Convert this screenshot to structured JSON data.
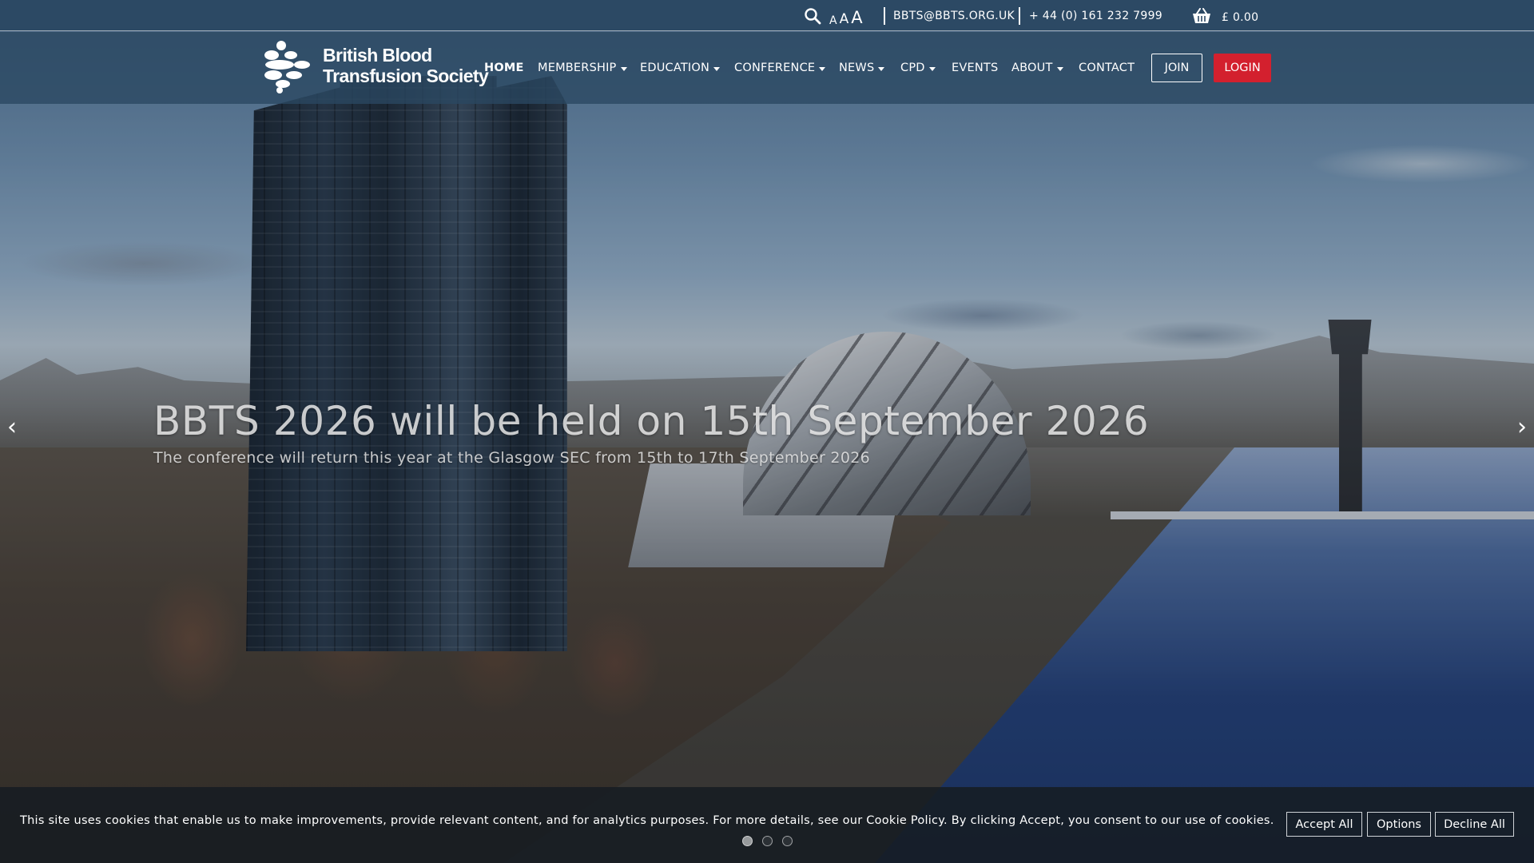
{
  "topbar": {
    "font_size_small": "A",
    "font_size_medium": "A",
    "font_size_large": "A",
    "email": "BBTS@BBTS.ORG.UK",
    "phone": "+ 44 (0) 161 232 7999",
    "basket_total": "£ 0.00"
  },
  "brand": {
    "line1": "British Blood",
    "line2": "Transfusion Society"
  },
  "nav": {
    "items": [
      {
        "label": "HOME",
        "active": true,
        "dropdown": false
      },
      {
        "label": "MEMBERSHIP",
        "active": false,
        "dropdown": true
      },
      {
        "label": "EDUCATION",
        "active": false,
        "dropdown": true
      },
      {
        "label": "CONFERENCE",
        "active": false,
        "dropdown": true
      },
      {
        "label": "NEWS",
        "active": false,
        "dropdown": true
      },
      {
        "label": "CPD",
        "active": false,
        "dropdown": true
      },
      {
        "label": "EVENTS",
        "active": false,
        "dropdown": false
      },
      {
        "label": "ABOUT",
        "active": false,
        "dropdown": true
      },
      {
        "label": "CONTACT",
        "active": false,
        "dropdown": false
      }
    ],
    "join_label": "JOIN",
    "login_label": "LOGIN"
  },
  "slider": {
    "title": "BBTS 2026 will be held on 15th September 2026",
    "subtitle": "The conference will return this year at the Glasgow SEC from 15th to 17th September 2026",
    "prev_icon": "chevron-left-icon",
    "next_icon": "chevron-right-icon",
    "slide_count": 3,
    "active_slide": 1
  },
  "cookie": {
    "message": "This site uses cookies that enable us to make improvements, provide relevant content, and for analytics purposes. For more details, see our Cookie Policy. By clicking Accept, you consent to our use of cookies.",
    "accept_label": "Accept All",
    "options_label": "Options",
    "decline_label": "Decline All"
  },
  "colors": {
    "topbar_bg": "#2c4964",
    "navbar_bg": "#2a4862",
    "login_bg": "#d3202e",
    "cookie_bg": "#161c22"
  }
}
